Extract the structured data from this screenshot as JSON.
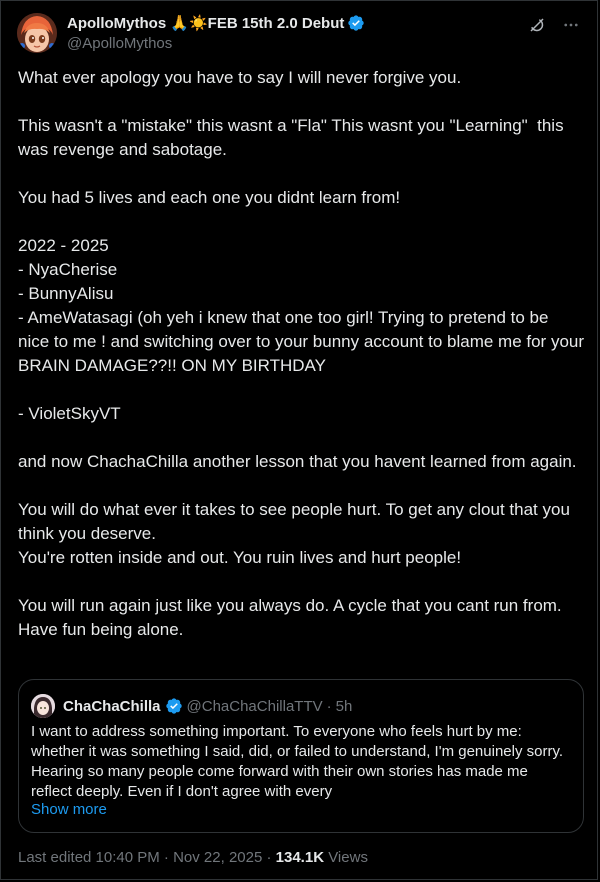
{
  "author": {
    "display_name": "ApolloMythos 🙏☀️FEB 15th 2.0 Debut",
    "handle": "@ApolloMythos"
  },
  "header_icons": [
    "grok-icon",
    "more-icon"
  ],
  "tweet": {
    "paragraphs": [
      "What ever apology you have to say I will never forgive you.",
      "This wasn't a \"mistake\" this wasnt a \"Fla\" This wasnt you \"Learning\"  this was revenge and sabotage.",
      "You had 5 lives and each one you didnt learn from!",
      "2022 - 2025\n- NyaCherise\n- BunnyAlisu\n- AmeWatasagi (oh yeh i knew that one too girl! Trying to pretend to be nice to me ! and switching over to your bunny account to blame me for your BRAIN DAMAGE??!! ON MY BIRTHDAY",
      "- VioletSkyVT",
      "and now ChachaChilla another lesson that you havent learned from again.",
      "You will do what ever it takes to see people hurt. To get any clout that you think you deserve.\nYou're rotten inside and out. You ruin lives and hurt people!",
      "You will run again just like you always do. A cycle that you cant run from. Have fun being alone."
    ]
  },
  "quote": {
    "display_name": "ChaChaChilla",
    "handle": "@ChaChaChillaTTV",
    "separator": "·",
    "time": "5h",
    "text": "I want to address something important. To everyone who feels hurt by me: whether it was something I said, did, or failed to understand, I'm genuinely sorry. Hearing so many people come forward with their own stories has made me reflect deeply. Even if I don't agree with every",
    "show_more": "Show more"
  },
  "footer": {
    "edited": "Last edited 10:40 PM · Nov 22, 2025 · ",
    "views_count": "134.1K",
    "views_label": " Views"
  },
  "colors": {
    "background": "#000000",
    "text": "#e7e9ea",
    "muted": "#71767b",
    "accent": "#1d9bf0",
    "border": "#2f3336"
  }
}
